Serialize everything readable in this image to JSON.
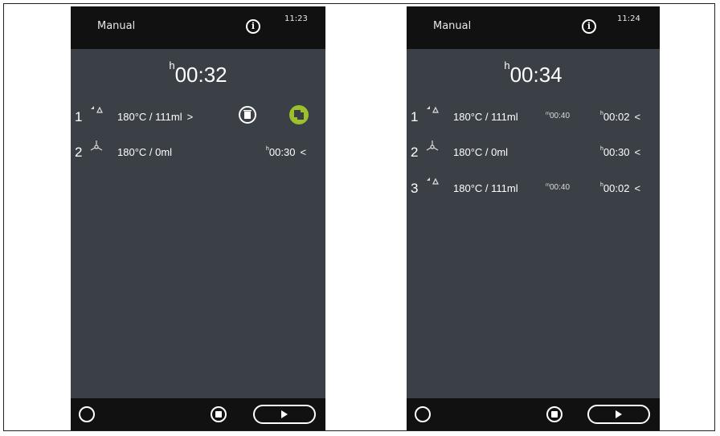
{
  "screens": [
    {
      "title": "Manual",
      "clock": "11:23",
      "total_prefix": "h",
      "total_time": "00:32",
      "rows": [
        {
          "num": "1",
          "icon": "steam-fan-icon",
          "temp": "180°C / 111ml",
          "arrow": ">"
        },
        {
          "num": "2",
          "icon": "fan-icon",
          "temp": "180°C / 0ml",
          "time_prefix": "h",
          "time": "00:30",
          "arrow": "<"
        }
      ],
      "actions": {
        "delete_icon": "trash-icon",
        "copy_icon": "copy-icon",
        "copy_color": "#9cc12d"
      }
    },
    {
      "title": "Manual",
      "clock": "11:24",
      "total_prefix": "h",
      "total_time": "00:34",
      "rows": [
        {
          "num": "1",
          "icon": "steam-fan-icon",
          "temp": "180°C / 111ml",
          "small_prefix": "m",
          "small": "00:40",
          "time_prefix": "h",
          "time": "00:02",
          "arrow": "<"
        },
        {
          "num": "2",
          "icon": "fan-icon",
          "temp": "180°C / 0ml",
          "time_prefix": "h",
          "time": "00:30",
          "arrow": "<"
        },
        {
          "num": "3",
          "icon": "steam-fan-icon",
          "temp": "180°C / 111ml",
          "small_prefix": "m",
          "small": "00:40",
          "time_prefix": "h",
          "time": "00:02",
          "arrow": "<"
        }
      ]
    }
  ],
  "colors": {
    "screen_bg": "#3a4046",
    "bar_bg": "#111111",
    "accent_green": "#9cc12d"
  }
}
